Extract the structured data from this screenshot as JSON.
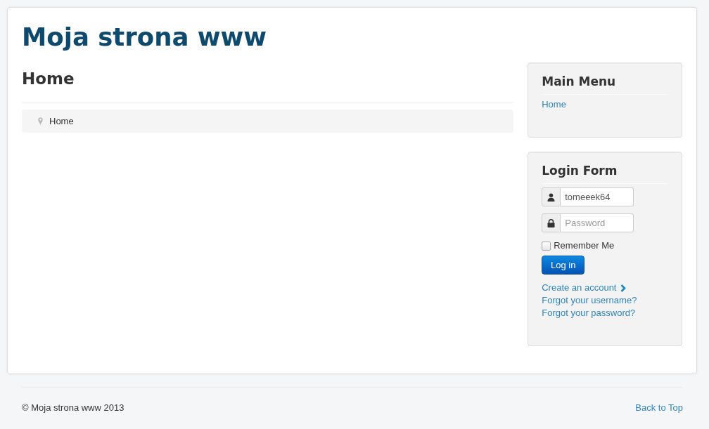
{
  "header": {
    "site_title": "Moja strona www"
  },
  "content": {
    "heading": "Home",
    "breadcrumb": [
      {
        "label": "Home"
      }
    ]
  },
  "sidebar": {
    "modules": [
      {
        "kind": "menu",
        "title": "Main Menu",
        "items": [
          {
            "label": "Home"
          }
        ]
      },
      {
        "kind": "login",
        "title": "Login Form",
        "username": {
          "value": "tomeeek64"
        },
        "password": {
          "placeholder": "Password"
        },
        "remember_me": {
          "label": "Remember Me",
          "checked": false
        },
        "submit_button": "Log in",
        "links": [
          {
            "label": "Create an account",
            "kind": "chevron"
          },
          {
            "label": "Forgot your username?",
            "kind": "plain"
          },
          {
            "label": "Forgot your password?",
            "kind": "plain"
          }
        ]
      }
    ]
  },
  "footer": {
    "copyright": "© Moja strona www 2013",
    "back_to_top": "Back to Top"
  }
}
